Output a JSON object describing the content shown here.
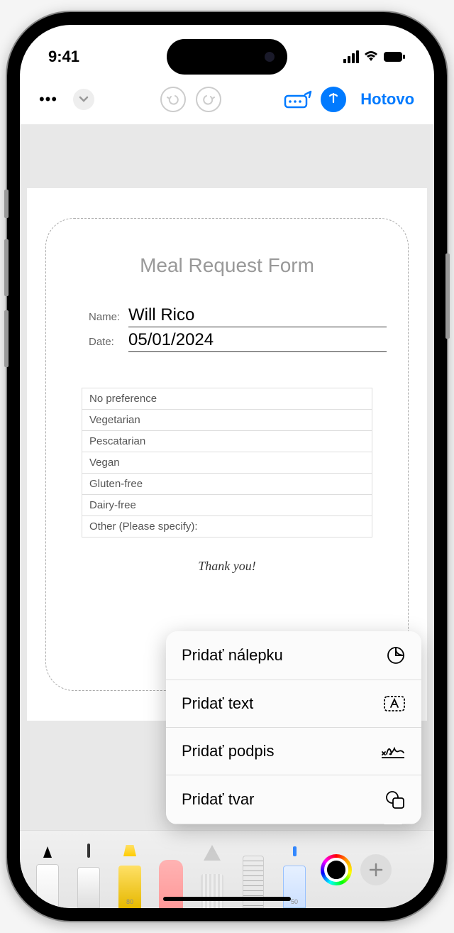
{
  "status": {
    "time": "9:41"
  },
  "toolbar": {
    "done": "Hotovo"
  },
  "form": {
    "title": "Meal Request Form",
    "name_label": "Name:",
    "name_value": "Will Rico",
    "date_label": "Date:",
    "date_value": "05/01/2024",
    "options": [
      "No preference",
      "Vegetarian",
      "Pescatarian",
      "Vegan",
      "Gluten-free",
      "Dairy-free",
      "Other (Please specify):"
    ],
    "thank_you": "Thank you!"
  },
  "menu": {
    "sticker": "Pridať nálepku",
    "text": "Pridať text",
    "signature": "Pridať podpis",
    "shape": "Pridať tvar"
  },
  "tools": {
    "highlighter_label": "80",
    "bluepen_label": "50"
  }
}
